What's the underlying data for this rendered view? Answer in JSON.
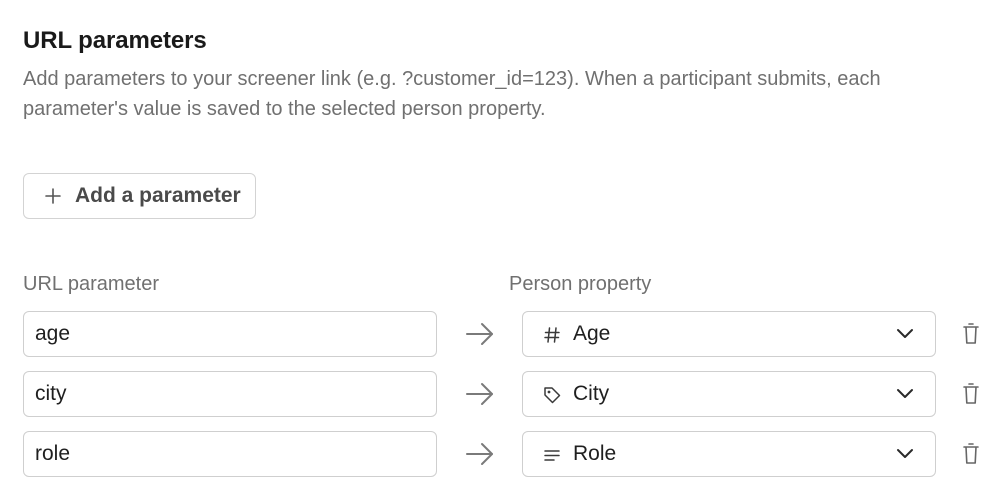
{
  "section": {
    "title": "URL parameters",
    "description": "Add parameters to your screener link (e.g. ?customer_id=123). When a participant submits, each parameter's value is saved to the selected person property."
  },
  "add_button": {
    "label": "Add a parameter",
    "icon": "plus-icon"
  },
  "columns": {
    "url_parameter": "URL parameter",
    "person_property": "Person property"
  },
  "rows": [
    {
      "parameter": "age",
      "property": "Age",
      "property_icon": "hash-icon"
    },
    {
      "parameter": "city",
      "property": "City",
      "property_icon": "tag-icon"
    },
    {
      "parameter": "role",
      "property": "Role",
      "property_icon": "lines-icon"
    }
  ],
  "colors": {
    "text_primary": "#1f1f1f",
    "text_muted": "#707070",
    "border": "#cfcfcf"
  }
}
